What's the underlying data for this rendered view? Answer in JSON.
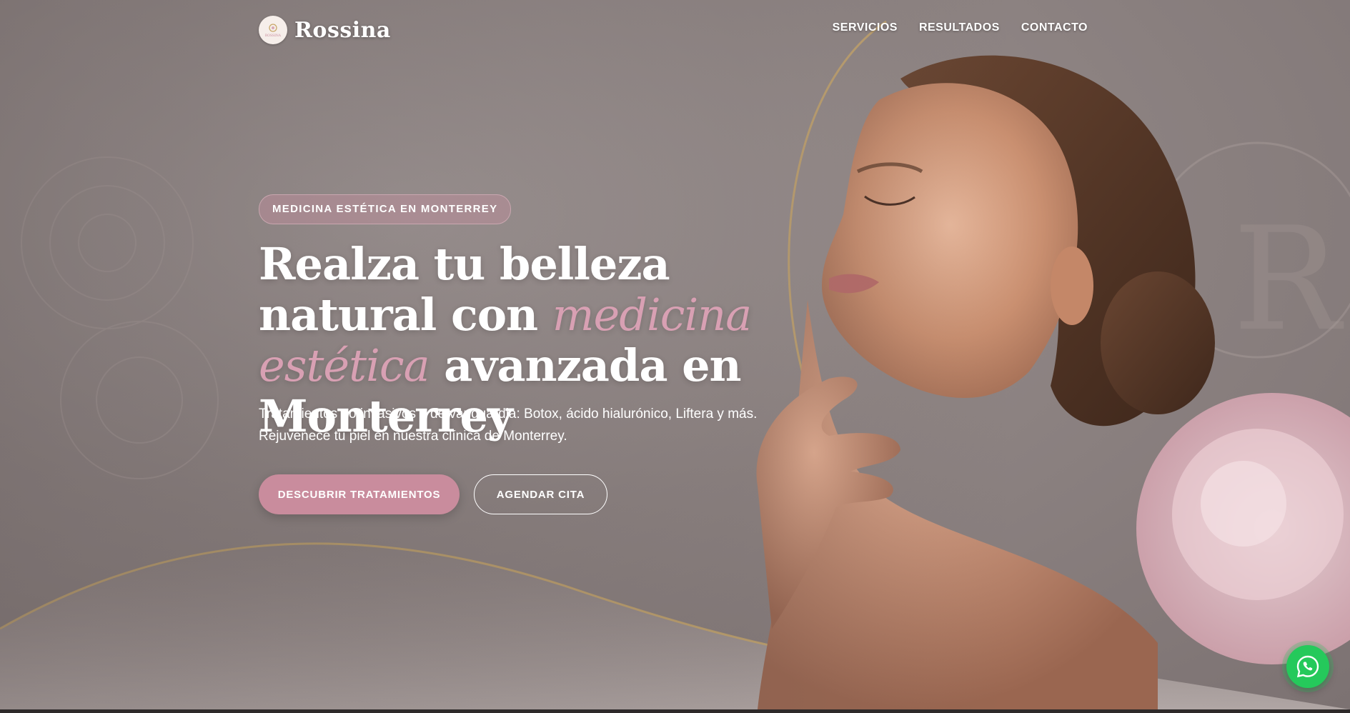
{
  "brand": {
    "name": "Rossina",
    "logo_text": "ROSSINA"
  },
  "nav": {
    "items": [
      "SERVICIOS",
      "RESULTADOS",
      "CONTACTO"
    ]
  },
  "hero": {
    "badge": "MEDICINA ESTÉTICA EN MONTERREY",
    "headline_part1": "Realza tu belleza natural con ",
    "headline_accent": "medicina estética",
    "headline_part2": " avanzada en Monterrey",
    "subtitle": "Tratamientos no invasivos y de vanguardia: Botox, ácido hialurónico, Liftera y más. Rejuvenece tu piel en nuestra clínica de Monterrey.",
    "primary_button": "DESCUBRIR TRATAMIENTOS",
    "secondary_button": "AGENDAR CITA"
  },
  "colors": {
    "accent_pink": "#c98c9d",
    "headline_accent": "#d8a0b3",
    "whatsapp_green": "#25c95b",
    "background": "#8f8584"
  },
  "icons": {
    "whatsapp": "whatsapp-icon",
    "logo": "rose-logo-icon"
  }
}
